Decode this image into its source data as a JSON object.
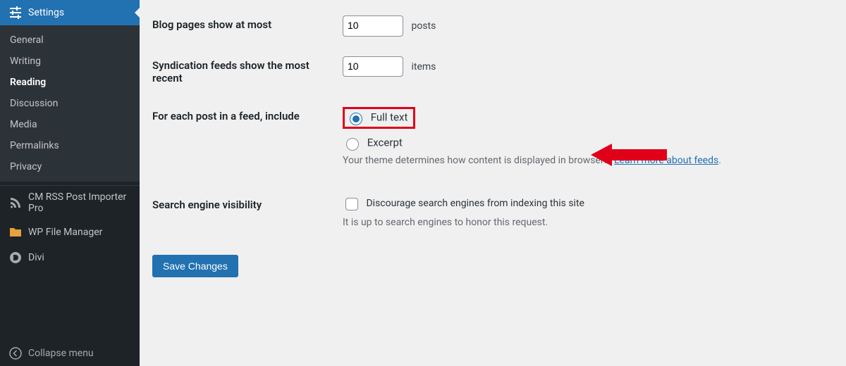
{
  "sidebar": {
    "settings_label": "Settings",
    "submenu": [
      {
        "label": "General"
      },
      {
        "label": "Writing"
      },
      {
        "label": "Reading"
      },
      {
        "label": "Discussion"
      },
      {
        "label": "Media"
      },
      {
        "label": "Permalinks"
      },
      {
        "label": "Privacy"
      }
    ],
    "plugins": [
      {
        "label": "CM RSS Post Importer Pro"
      },
      {
        "label": "WP File Manager"
      },
      {
        "label": "Divi"
      }
    ],
    "collapse_label": "Collapse menu"
  },
  "settings": {
    "blog_pages": {
      "label": "Blog pages show at most",
      "value": "10",
      "suffix": "posts"
    },
    "syndication": {
      "label": "Syndication feeds show the most recent",
      "value": "10",
      "suffix": "items"
    },
    "feed_include": {
      "label": "For each post in a feed, include",
      "full_text": "Full text",
      "excerpt": "Excerpt",
      "desc_prefix": "Your theme determines how content is displayed in browsers. ",
      "desc_link": "Learn more about feeds",
      "desc_suffix": "."
    },
    "sev": {
      "label": "Search engine visibility",
      "checkbox_label": "Discourage search engines from indexing this site",
      "desc": "It is up to search engines to honor this request."
    },
    "save_label": "Save Changes"
  }
}
